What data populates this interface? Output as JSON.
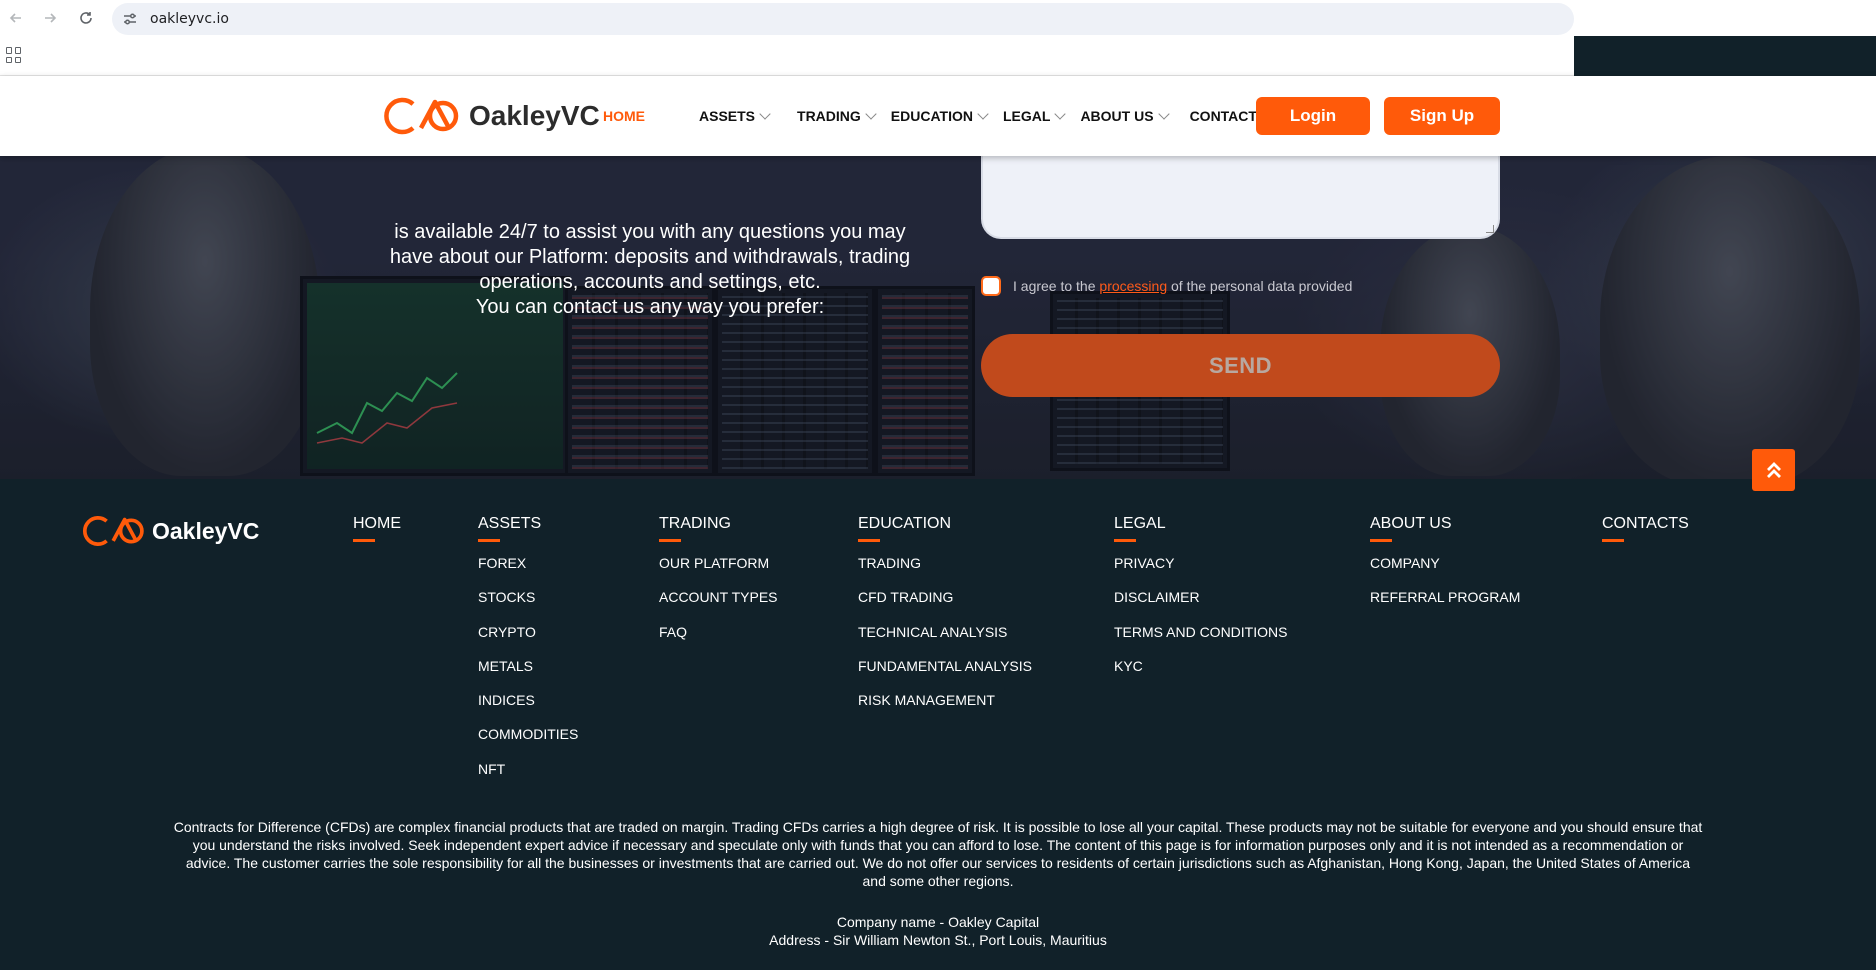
{
  "browser": {
    "url": "oakleyvc.io",
    "back_icon": "arrow-left-icon",
    "forward_icon": "arrow-right-icon",
    "reload_icon": "reload-icon",
    "site_settings_icon": "tune-icon",
    "apps_icon": "apps-grid-icon"
  },
  "colors": {
    "brand": "#ff5a0a",
    "footer_bg": "#112129",
    "header_bg": "#ffffff"
  },
  "header": {
    "logo_text": "OakleyVC",
    "menu": [
      {
        "label": "HOME",
        "active": true,
        "dropdown": false
      },
      {
        "label": "ASSETS",
        "active": false,
        "dropdown": true
      },
      {
        "label": "TRADING",
        "active": false,
        "dropdown": true
      },
      {
        "label": "EDUCATION",
        "active": false,
        "dropdown": true
      },
      {
        "label": "LEGAL",
        "active": false,
        "dropdown": true
      },
      {
        "label": "ABOUT US",
        "active": false,
        "dropdown": true
      },
      {
        "label": "CONTACTS",
        "active": false,
        "dropdown": false
      }
    ],
    "login_label": "Login",
    "signup_label": "Sign Up"
  },
  "hero": {
    "intro_lines": [
      "is available 24/7 to assist you with any questions you may",
      "have about our Platform: deposits and withdrawals, trading",
      "operations, accounts and settings, etc.",
      "You can contact us any way you prefer:"
    ],
    "agree_prefix": "I agree to the",
    "agree_link": "processing",
    "agree_suffix": "of the personal data provided",
    "send_label": "SEND"
  },
  "footer": {
    "logo_text": "OakleyVC",
    "columns": [
      {
        "heading": "HOME",
        "links": []
      },
      {
        "heading": "ASSETS",
        "links": [
          "FOREX",
          "STOCKS",
          "CRYPTO",
          "METALS",
          "INDICES",
          "COMMODITIES",
          "NFT"
        ]
      },
      {
        "heading": "TRADING",
        "links": [
          "OUR PLATFORM",
          "ACCOUNT TYPES",
          "FAQ"
        ]
      },
      {
        "heading": "EDUCATION",
        "links": [
          "TRADING",
          "CFD TRADING",
          "TECHNICAL ANALYSIS",
          "FUNDAMENTAL ANALYSIS",
          "RISK MANAGEMENT"
        ]
      },
      {
        "heading": "LEGAL",
        "links": [
          "PRIVACY",
          "DISCLAIMER",
          "TERMS AND CONDITIONS",
          "KYC"
        ]
      },
      {
        "heading": "ABOUT US",
        "links": [
          "COMPANY",
          "REFERRAL PROGRAM"
        ]
      },
      {
        "heading": "CONTACTS",
        "links": []
      }
    ],
    "disclaimer_lines": [
      "Contracts for Difference (CFDs) are complex financial products that are traded on margin. Trading CFDs carries a high degree of risk. It is possible to lose all your capital. These products may not be suitable for everyone and you should ensure that",
      "you understand the risks involved. Seek independent expert advice if necessary and speculate only with funds that you can afford to lose. The content of this page is for information purposes only and it is not intended as a recommendation or",
      "advice. The customer carries the sole responsibility for all the businesses or investments that are carried out. We do not offer our services to residents of certain jurisdictions such as Afghanistan, Hong Kong, Japan, the United States of America",
      "and some other regions."
    ],
    "company_name": "Company name - Oakley Capital",
    "address": "Address - Sir William Newton St., Port Louis, Mauritius",
    "scroll_top_icon": "double-chevron-up-icon"
  }
}
